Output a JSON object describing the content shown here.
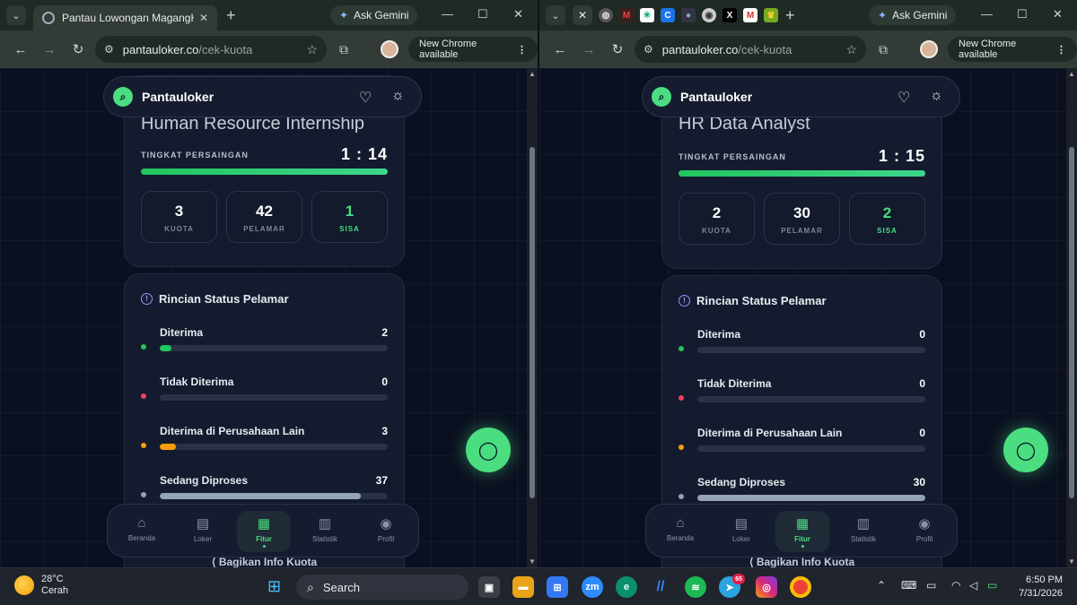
{
  "browser": {
    "left_tab_title": "Pantau Lowongan MagangHub",
    "ask_gemini": "Ask Gemini",
    "url_host": "pantauloker.co",
    "url_path": "/cek-kuota",
    "new_chrome": "New Chrome available"
  },
  "app": {
    "brand": "Pantauloker",
    "competition_label": "TINGKAT PERSAINGAN",
    "status_title": "Rincian Status Pelamar",
    "share_label": "Bagikan Info Kuota",
    "nav": [
      {
        "label": "Beranda",
        "icon": "home-icon"
      },
      {
        "label": "Loker",
        "icon": "briefcase-icon"
      },
      {
        "label": "Fitur",
        "icon": "grid-icon"
      },
      {
        "label": "Statistik",
        "icon": "bar-chart-icon"
      },
      {
        "label": "Profil",
        "icon": "user-icon"
      }
    ]
  },
  "panels": [
    {
      "job_title": "Human Resource Internship",
      "ratio": "1 : 14",
      "stats": [
        {
          "value": "3",
          "label": "KUOTA"
        },
        {
          "value": "42",
          "label": "PELAMAR"
        },
        {
          "value": "1",
          "label": "SISA"
        }
      ],
      "status_rows": [
        {
          "label": "Diterima",
          "value": "2",
          "fraction": 0.05,
          "color": "#22c55e"
        },
        {
          "label": "Tidak Diterima",
          "value": "0",
          "fraction": 0,
          "color": "#f43f5e"
        },
        {
          "label": "Diterima di Perusahaan Lain",
          "value": "3",
          "fraction": 0.07,
          "color": "#f59e0b"
        },
        {
          "label": "Sedang Diproses",
          "value": "37",
          "fraction": 0.88,
          "color": "#94a3b8"
        }
      ]
    },
    {
      "job_title": "HR Data Analyst",
      "ratio": "1 : 15",
      "stats": [
        {
          "value": "2",
          "label": "KUOTA"
        },
        {
          "value": "30",
          "label": "PELAMAR"
        },
        {
          "value": "2",
          "label": "SISA"
        }
      ],
      "status_rows": [
        {
          "label": "Diterima",
          "value": "0",
          "fraction": 0,
          "color": "#22c55e"
        },
        {
          "label": "Tidak Diterima",
          "value": "0",
          "fraction": 0,
          "color": "#f43f5e"
        },
        {
          "label": "Diterima di Perusahaan Lain",
          "value": "0",
          "fraction": 0,
          "color": "#f59e0b"
        },
        {
          "label": "Sedang Diproses",
          "value": "30",
          "fraction": 1,
          "color": "#94a3b8"
        }
      ]
    }
  ],
  "taskbar": {
    "temp": "28°C",
    "weather": "Cerah",
    "search": "Search",
    "time": "6:50 PM",
    "date": "7/31/2026",
    "telegram_badge": "65"
  }
}
